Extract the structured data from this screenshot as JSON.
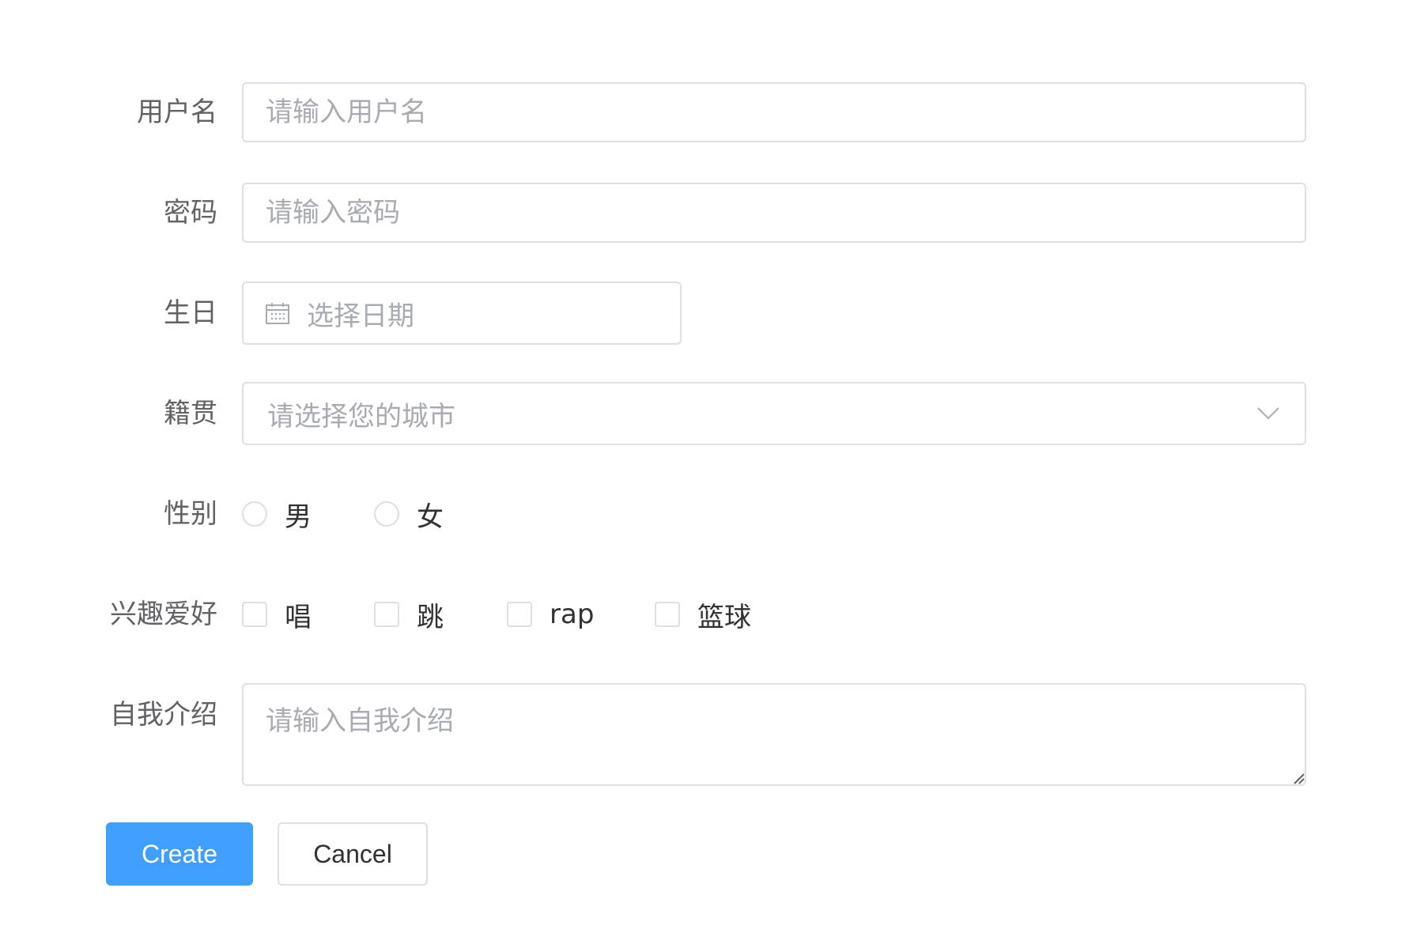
{
  "form": {
    "username": {
      "label": "用户名",
      "placeholder": "请输入用户名",
      "value": ""
    },
    "password": {
      "label": "密码",
      "placeholder": "请输入密码",
      "value": ""
    },
    "birthday": {
      "label": "生日",
      "placeholder": "选择日期",
      "icon": "calendar-icon"
    },
    "hometown": {
      "label": "籍贯",
      "placeholder": "请选择您的城市",
      "icon": "chevron-down-icon"
    },
    "gender": {
      "label": "性别",
      "options": [
        "男",
        "女"
      ],
      "selected": null
    },
    "hobbies": {
      "label": "兴趣爱好",
      "options": [
        "唱",
        "跳",
        "rap",
        "篮球"
      ],
      "checked": []
    },
    "intro": {
      "label": "自我介绍",
      "placeholder": "请输入自我介绍",
      "value": ""
    }
  },
  "actions": {
    "create_label": "Create",
    "cancel_label": "Cancel"
  },
  "colors": {
    "primary": "#409eff",
    "border": "#dcdfe6",
    "placeholder": "#a8abb2",
    "label": "#606266"
  }
}
